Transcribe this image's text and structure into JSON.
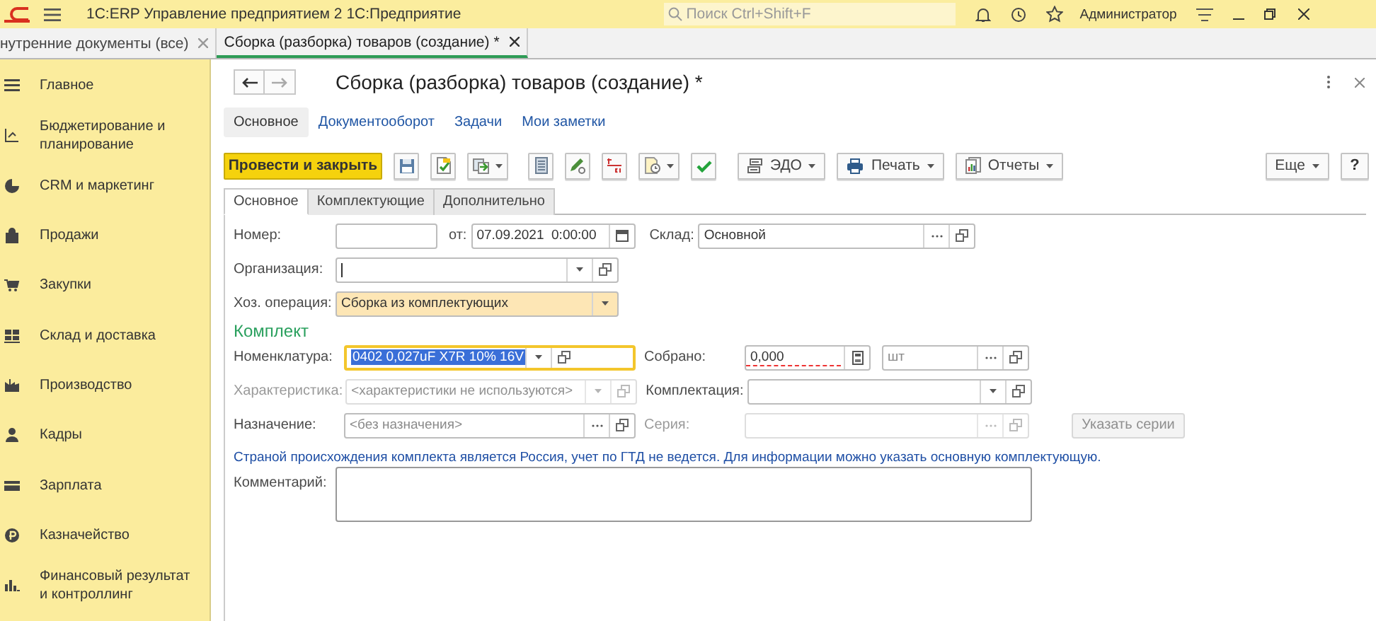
{
  "app_bar": {
    "title": "1С:ERP Управление предприятием 2 1С:Предприятие",
    "search": {
      "placeholder": "Поиск Ctrl+Shift+F"
    },
    "user": "Администратор"
  },
  "open_tabs": [
    {
      "label": "нутренние документы (все)",
      "selected": false
    },
    {
      "label": "Сборка (разборка) товаров (создание) *",
      "selected": true
    }
  ],
  "sidebar": {
    "items": [
      {
        "label": "Главное"
      },
      {
        "label": "Бюджетирование и планирование"
      },
      {
        "label": "CRM и маркетинг"
      },
      {
        "label": "Продажи"
      },
      {
        "label": "Закупки"
      },
      {
        "label": "Склад и доставка"
      },
      {
        "label": "Производство"
      },
      {
        "label": "Кадры"
      },
      {
        "label": "Зарплата"
      },
      {
        "label": "Казначейство"
      },
      {
        "label": "Финансовый результат и контроллинг"
      }
    ]
  },
  "form": {
    "title": "Сборка (разборка) товаров (создание) *",
    "nav_links": [
      {
        "label": "Основное",
        "selected": true
      },
      {
        "label": "Документооборот",
        "selected": false
      },
      {
        "label": "Задачи",
        "selected": false
      },
      {
        "label": "Мои заметки",
        "selected": false
      }
    ],
    "toolbar": {
      "primary": "Провести и закрыть",
      "edo": "ЭДО",
      "print": "Печать",
      "reports": "Отчеты",
      "more": "Еще",
      "help": "?"
    },
    "tabs": [
      {
        "label": "Основное",
        "selected": true
      },
      {
        "label": "Комплектующие",
        "selected": false
      },
      {
        "label": "Дополнительно",
        "selected": false
      }
    ],
    "number": {
      "label": "Номер:"
    },
    "date": {
      "label": "от:",
      "value": "07.09.2021  0:00:00"
    },
    "warehouse": {
      "label": "Склад:",
      "value": "Основной"
    },
    "organization": {
      "label": "Организация:",
      "text_cursor": true
    },
    "operation": {
      "label": "Хоз. операция:",
      "value": "Сборка из комплектующих",
      "highlighted": true
    },
    "section_title": "Комплект",
    "item": {
      "label": "Номенклатура:",
      "value": "0402 0,027uF X7R 10% 16V",
      "focused": true,
      "value_selected": true
    },
    "assembled": {
      "label": "Собрано:",
      "value": "0,000",
      "invalid": true
    },
    "unit": {
      "placeholder": "шт"
    },
    "characteristic": {
      "label": "Характеристика:",
      "placeholder": "<характеристики не используются>",
      "disabled": true
    },
    "kit": {
      "label": "Комплектация:"
    },
    "purpose": {
      "label": "Назначение:",
      "placeholder": "<без назначения>"
    },
    "series": {
      "label": "Серия:",
      "disabled": true
    },
    "series_button": {
      "label": "Указать серии",
      "disabled": true
    },
    "info": "Страной происхождения комплекта является Россия, учет по ГТД не ведется. Для информации можно указать основную комплектующую.",
    "comment": {
      "label": "Комментарий:"
    }
  }
}
